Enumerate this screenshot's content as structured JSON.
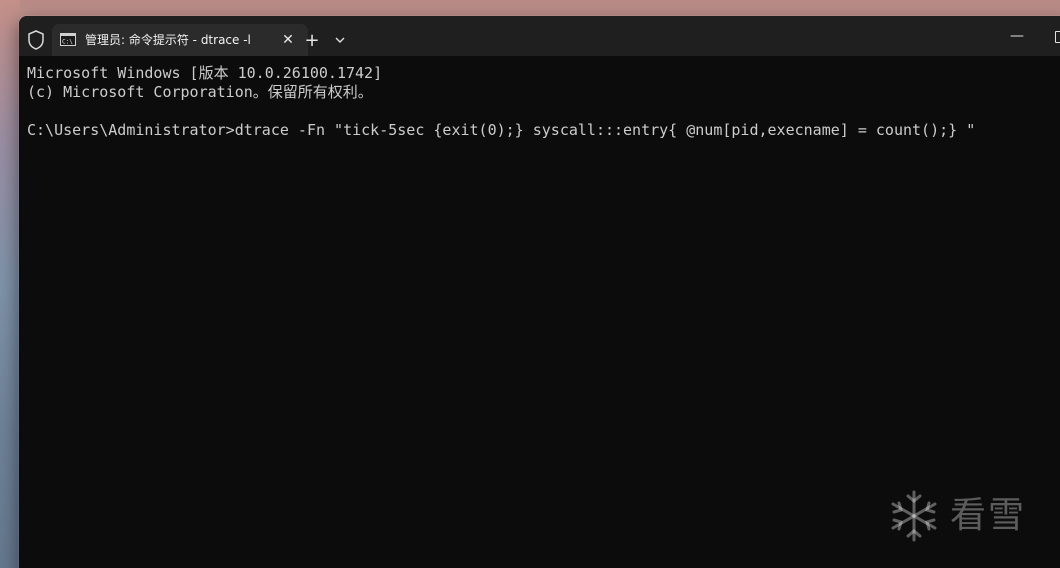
{
  "window": {
    "tab_title": "管理员: 命令提示符 - dtrace  -l",
    "tab_close": "✕",
    "new_tab": "+",
    "minimize": "—"
  },
  "terminal": {
    "lines": [
      "Microsoft Windows [版本 10.0.26100.1742]",
      "(c) Microsoft Corporation。保留所有权利。",
      "",
      "C:\\Users\\Administrator>dtrace -Fn \"tick-5sec {exit(0);} syscall:::entry{ @num[pid,execname] = count();} \""
    ]
  },
  "watermark": {
    "text": "看雪"
  },
  "icons": {
    "shield": "shield-icon",
    "terminal": "terminal-icon",
    "dropdown": "chevron-down-icon",
    "watermark_logo": "snowflake-icon"
  },
  "colors": {
    "terminal_bg": "#0c0c0c",
    "terminal_text": "#cccccc",
    "titlebar_bg": "#1f1f1f",
    "tab_bg": "#2b2b2b"
  }
}
